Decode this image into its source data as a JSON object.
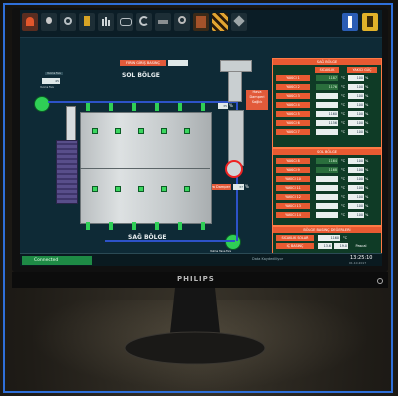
{
  "brand": "PHILIPS",
  "toolbar": {
    "icons": [
      "alarm-icon",
      "lamp-icon",
      "gear-icon",
      "fuel-icon",
      "bars-icon",
      "settings-icon",
      "refresh-icon",
      "burner-icon",
      "fan-icon",
      "pump-icon",
      "stripes-icon",
      "tools-icon",
      "info-icon",
      "exit-icon"
    ]
  },
  "process": {
    "left_zone_title": "SOL BÖLGE",
    "bottom_zone_title": "SAĞ BÖLGE",
    "top_button": "FIRIN GİRİŞ BASINÇ",
    "top_value": "",
    "left_fan_label": "Yanma Fanı",
    "bottom_fan_label": "Yakma Hava Fanı",
    "damper_button": "Hava Damper",
    "damper_value": "37",
    "damper_unit": "%",
    "burner_button_line1": "Hava",
    "burner_button_line2": "Damperi",
    "burner_button_line3": "Sağlık",
    "mid_value": "35",
    "mid_unit": "%",
    "fan_value_label": "Yanma Fanı",
    "fan_value": "45"
  },
  "sag_panel": {
    "title": "SAĞ BÖLGE",
    "col1": "SICAKLIK",
    "col2": "YAKICI GÜÇ",
    "rows": [
      {
        "label": "YAKICI 1",
        "value": "1187",
        "unit": "°C",
        "value2": "100",
        "unit2": "%"
      },
      {
        "label": "YAKICI 2",
        "value": "1176",
        "unit": "°C",
        "value2": "100",
        "unit2": "%"
      },
      {
        "label": "YAKICI 3",
        "value": "",
        "unit": "°C",
        "value2": "100",
        "unit2": "%"
      },
      {
        "label": "YAKICI 4",
        "value": "",
        "unit": "°C",
        "value2": "100",
        "unit2": "%"
      },
      {
        "label": "YAKICI 5",
        "value": "1160",
        "unit": "°C",
        "value2": "100",
        "unit2": "%"
      },
      {
        "label": "YAKICI 6",
        "value": "1156",
        "unit": "°C",
        "value2": "100",
        "unit2": "%"
      },
      {
        "label": "YAKICI 7",
        "value": "",
        "unit": "°C",
        "value2": "100",
        "unit2": "%"
      }
    ]
  },
  "sol_panel": {
    "title": "SOL BÖLGE",
    "rows": [
      {
        "label": "YAKICI 8",
        "value": "1164",
        "unit": "°C",
        "value2": "100",
        "unit2": "%"
      },
      {
        "label": "YAKICI 9",
        "value": "1168",
        "unit": "°C",
        "value2": "100",
        "unit2": "%"
      },
      {
        "label": "YAKICI 10",
        "value": "",
        "unit": "°C",
        "value2": "100",
        "unit2": "%"
      },
      {
        "label": "YAKICI 11",
        "value": "",
        "unit": "°C",
        "value2": "100",
        "unit2": "%"
      },
      {
        "label": "YAKICI 12",
        "value": "",
        "unit": "°C",
        "value2": "100",
        "unit2": "%"
      },
      {
        "label": "YAKICI 13",
        "value": "",
        "unit": "°C",
        "value2": "100",
        "unit2": "%"
      },
      {
        "label": "YAKICI 14",
        "value": "",
        "unit": "°C",
        "value2": "100",
        "unit2": "%"
      }
    ]
  },
  "bottom_panel": {
    "title": "BÖLGE BASINÇ DEĞERLERİ",
    "row1_label": "SICAKLIK SOLAR",
    "row1_value": "1160",
    "row1_unit": "°C",
    "row2_label": "İÇ BASINÇ",
    "row2_value": "13.6",
    "row2_value2": "19.0",
    "row2_unit": "Pascal"
  },
  "status": {
    "connection": "Connected",
    "middle": "Data Kaydediliyor",
    "time": "13:25:10",
    "date": "01.10.2017"
  },
  "colors": {
    "accent": "#e85a32",
    "ok": "#3ad65e",
    "panel": "#0f3b26",
    "screen": "#0e2a36"
  }
}
